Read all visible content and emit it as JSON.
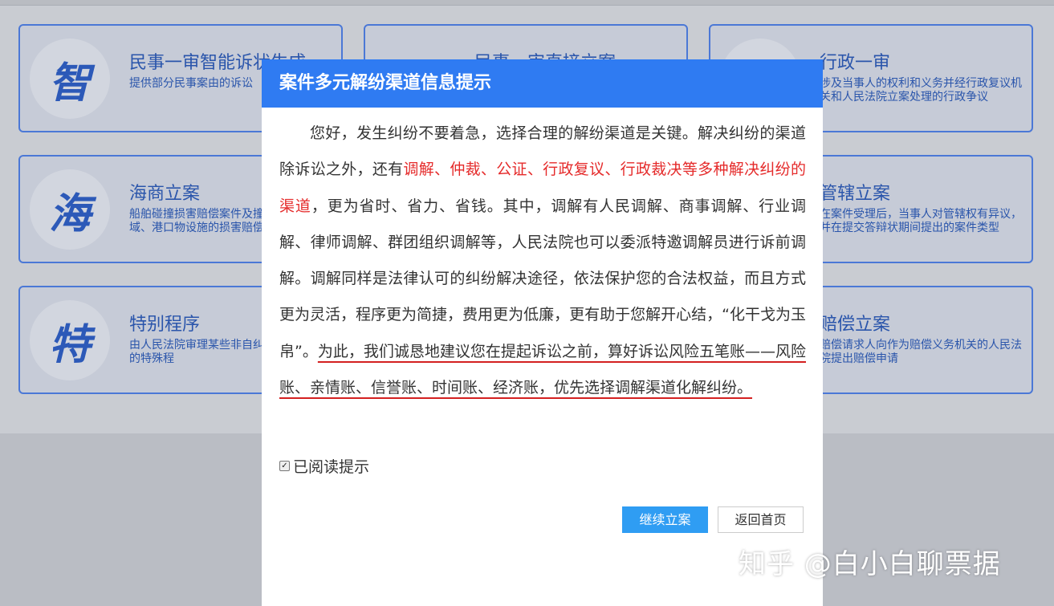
{
  "cards": [
    {
      "icon": "智",
      "title": "民事一审智能诉状生成",
      "desc": "提供部分民事案由的诉讼"
    },
    {
      "icon": "",
      "title": "民事一审直接立案",
      "desc": ""
    },
    {
      "icon": "",
      "title": "行政一审",
      "desc": "涉及当事人的权利和义务并经行政复议机关和人民法院立案处理的行政争议"
    },
    {
      "icon": "海",
      "title": "海商立案",
      "desc": "船舶碰撞损害赔偿案件及撞海上、通海水域、港口物设施的损害赔偿案件"
    },
    {
      "icon": "",
      "title": "管辖立案",
      "desc": "在案件受理后，当事人对管辖权有异议，并在提交答辩状期间提出的案件类型"
    },
    {
      "icon": "特",
      "title": "特别程序",
      "desc": "由人民法院审理某些非自纠纷案件所使用的特殊程"
    },
    {
      "icon": "",
      "title": "赔偿立案",
      "desc": "赔偿请求人向作为赔偿义务机关的人民法院提出赔偿申请"
    }
  ],
  "modal": {
    "title": "案件多元解纷渠道信息提示",
    "p1": "您好，发生纠纷不要着急，选择合理的解纷渠道是关键。解决纠纷的渠道除诉讼之外，还有",
    "red": "调解、仲裁、公证、行政复议、行政裁决等多种解决纠纷的渠道",
    "p2": "，更为省时、省力、省钱。其中，调解有人民调解、商事调解、行业调解、律师调解、群团组织调解等，人民法院也可以委派特邀调解员进行诉前调解。调解同样是法律认可的纠纷解决途径，依法保护您的合法权益，而且方式更为灵活，程序更为简捷，费用更为低廉，更有助于您解开心结，“化干戈为玉帛”。",
    "highlight": "为此，我们诚恳地建议您在提起诉讼之前，算好诉讼风险五笔账——风险账、亲情账、信誉账、时间账、经济账，优先选择调解渠道化解纠纷。",
    "read_label": "已阅读提示",
    "continue_label": "继续立案",
    "back_label": "返回首页"
  },
  "watermark": "知乎 @白小白聊票据"
}
